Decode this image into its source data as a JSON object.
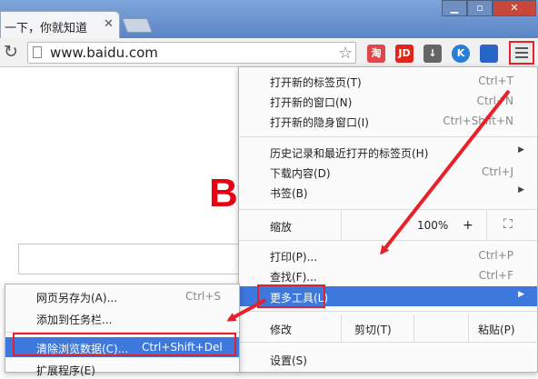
{
  "tab": {
    "title": "一下，你就知道",
    "close": "✕"
  },
  "window_buttons": {
    "minimize": "▁",
    "maximize": "▫",
    "close": "✕"
  },
  "toolbar": {
    "url": "www.baidu.com"
  },
  "extensions": [
    {
      "name": "taobao",
      "text": "淘",
      "color": "#e0474c"
    },
    {
      "name": "jd",
      "text": "JD",
      "color": "#e1251b"
    },
    {
      "name": "download",
      "text": "↓",
      "color": "#666666"
    },
    {
      "name": "k",
      "text": "K",
      "color": "#2a7fd4"
    },
    {
      "name": "paw",
      "text": "🐾",
      "color": "#2b63c6"
    }
  ],
  "page": {
    "logo_letter": "B"
  },
  "menu": {
    "new_tab": {
      "label": "打开新的标签页(T)",
      "shortcut": "Ctrl+T"
    },
    "new_window": {
      "label": "打开新的窗口(N)",
      "shortcut": "Ctrl+N"
    },
    "incognito": {
      "label": "打开新的隐身窗口(I)",
      "shortcut": "Ctrl+Shift+N"
    },
    "history": {
      "label": "历史记录和最近打开的标签页(H)"
    },
    "downloads": {
      "label": "下载内容(D)",
      "shortcut": "Ctrl+J"
    },
    "bookmarks": {
      "label": "书签(B)"
    },
    "zoom": {
      "label": "缩放",
      "value": "100%",
      "plus": "+",
      "fullscreen": "⛶"
    },
    "print": {
      "label": "打印(P)...",
      "shortcut": "Ctrl+P"
    },
    "find": {
      "label": "查找(F)...",
      "shortcut": "Ctrl+F"
    },
    "more_tools": {
      "label": "更多工具(L)"
    },
    "edit": {
      "label": "修改",
      "cut": "剪切(T)",
      "paste": "粘贴(P)"
    },
    "settings": {
      "label": "设置(S)"
    }
  },
  "submenu": {
    "save_page": {
      "label": "网页另存为(A)...",
      "shortcut": "Ctrl+S"
    },
    "add_taskbar": {
      "label": "添加到任务栏..."
    },
    "clear_data": {
      "label": "清除浏览数据(C)...",
      "shortcut": "Ctrl+Shift+Del"
    },
    "extensions": {
      "label": "扩展程序(E)"
    }
  },
  "colors": {
    "highlight": "#3d78dc",
    "annotation": "#e8202a"
  }
}
